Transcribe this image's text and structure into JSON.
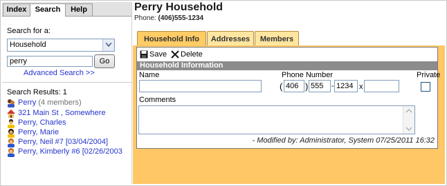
{
  "left_tabs": [
    "Index",
    "Search",
    "Help"
  ],
  "search": {
    "label": "Search for a:",
    "type_value": "Household",
    "query_value": "perry",
    "go_label": "Go",
    "advanced_link": "Advanced Search >>"
  },
  "results": {
    "label": "Search Results: 1",
    "items": [
      {
        "icon": "household-icon",
        "text": "Perry",
        "extra": " (4 members)"
      },
      {
        "icon": "address-icon",
        "text": "321 Main St , Somewhere",
        "extra": ""
      },
      {
        "icon": "male-member-icon",
        "text": "Perry, Charles",
        "extra": ""
      },
      {
        "icon": "female-member-icon",
        "text": "Perry, Marie",
        "extra": ""
      },
      {
        "icon": "child-member-icon",
        "text": "Perry, Neil #7 [03/04/2004]",
        "extra": ""
      },
      {
        "icon": "child-member-icon",
        "text": "Perry, Kimberly #6 [02/26/2003",
        "extra": ""
      }
    ]
  },
  "header": {
    "title": "Perry Household",
    "phone_label": "Phone:",
    "phone_value": "(406)555-1234"
  },
  "tabs": [
    "Household Info",
    "Addresses",
    "Members"
  ],
  "toolbar": {
    "save_label": "Save",
    "delete_label": "Delete"
  },
  "section_title": "Household Information",
  "form": {
    "name_label": "Name",
    "name_value": "",
    "phone_label": "Phone Number",
    "area_code": "406",
    "prefix": "555",
    "line": "1234",
    "ext_sep": "x",
    "extension": "",
    "private_label": "Private",
    "comments_label": "Comments",
    "comments_value": ""
  },
  "modified": "- Modified by: Administrator, System 07/25/2011 16:32",
  "colors": {
    "accent": "#ffc766",
    "link": "#2433cc",
    "section_header": "#8c8c8c"
  }
}
